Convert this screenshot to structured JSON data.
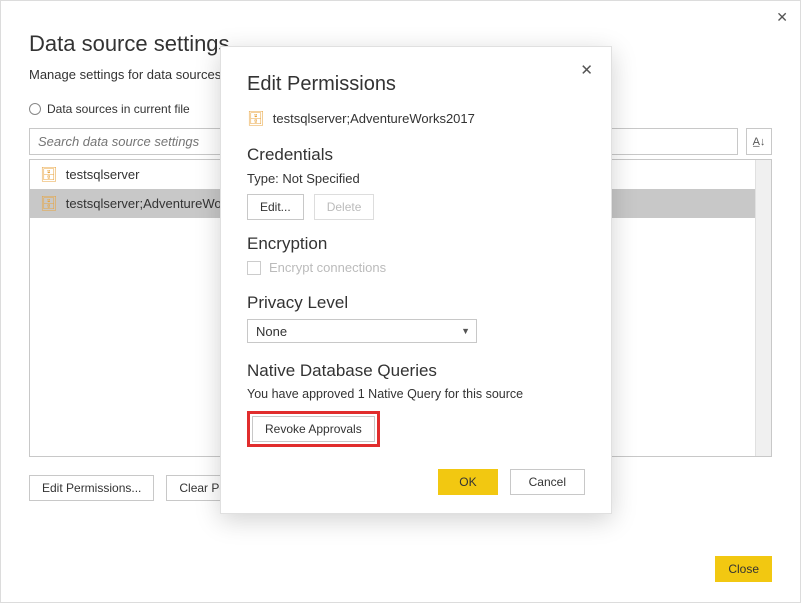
{
  "window": {
    "title": "Data source settings",
    "subtitle": "Manage settings for data sources that you have connected to using Power BI Desktop.",
    "radio_label": "Data sources in current file",
    "search_placeholder": "Search data source settings",
    "sort_icon": "A↓Z",
    "sources": [
      {
        "name": "testsqlserver"
      },
      {
        "name": "testsqlserver;AdventureWorks2017"
      }
    ],
    "edit_permissions_btn": "Edit Permissions...",
    "clear_permissions_btn": "Clear Permissions",
    "close_btn": "Close"
  },
  "dialog": {
    "title": "Edit Permissions",
    "source_name": "testsqlserver;AdventureWorks2017",
    "credentials": {
      "header": "Credentials",
      "type_label": "Type: Not Specified",
      "edit_btn": "Edit...",
      "delete_btn": "Delete"
    },
    "encryption": {
      "header": "Encryption",
      "checkbox_label": "Encrypt connections"
    },
    "privacy": {
      "header": "Privacy Level",
      "value": "None"
    },
    "native": {
      "header": "Native Database Queries",
      "msg": "You have approved 1 Native Query for this source",
      "revoke_btn": "Revoke Approvals"
    },
    "ok_btn": "OK",
    "cancel_btn": "Cancel"
  }
}
